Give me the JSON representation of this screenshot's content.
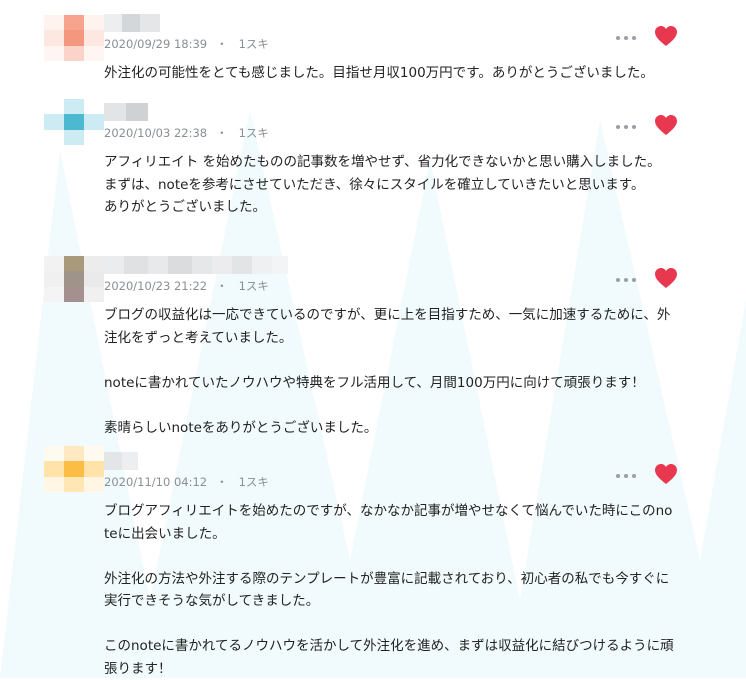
{
  "colors": {
    "heart": "#e8384f",
    "meta_text": "#8a8f94",
    "body_text": "#222222",
    "pattern": "#edf8fb"
  },
  "comments": [
    {
      "date": "2020/09/29 18:39",
      "separator": "・",
      "likes": "1スキ",
      "more_icon": "ellipsis-horizontal",
      "like_icon": "heart-filled",
      "body": [
        "外注化の可能性をとても感じました。目指せ月収100万円です。ありがとうございました。"
      ]
    },
    {
      "date": "2020/10/03 22:38",
      "separator": "・",
      "likes": "1スキ",
      "more_icon": "ellipsis-horizontal",
      "like_icon": "heart-filled",
      "body": [
        "アフィリエイト を始めたものの記事数を増やせず、省力化できないかと思い購入しました。",
        "まずは、noteを参考にさせていただき、徐々にスタイルを確立していきたいと思います。",
        "ありがとうございました。"
      ]
    },
    {
      "date": "2020/10/23 21:22",
      "separator": "・",
      "likes": "1スキ",
      "more_icon": "ellipsis-horizontal",
      "like_icon": "heart-filled",
      "body": [
        "ブログの収益化は一応できているのですが、更に上を目指すため、一気に加速するために、外注化をずっと考えていました。",
        "",
        "noteに書かれていたノウハウや特典をフル活用して、月間100万円に向けて頑張ります！",
        "",
        "素晴らしいnoteをありがとうございました。"
      ]
    },
    {
      "date": "2020/11/10 04:12",
      "separator": "・",
      "likes": "1スキ",
      "more_icon": "ellipsis-horizontal",
      "like_icon": "heart-filled",
      "body": [
        "ブログアフィリエイトを始めたのですが、なかなか記事が増やせなくて悩んでいた時にこのnoteに出会いました。",
        "",
        "外注化の方法や外注する際のテンプレートが豊富に記載されており、初心者の私でも今すぐに実行できそうな気がしてきました。",
        "",
        "このnoteに書かれてるノウハウを活かして外注化を進め、まずは収益化に結びつけるように頑張ります！"
      ]
    }
  ]
}
